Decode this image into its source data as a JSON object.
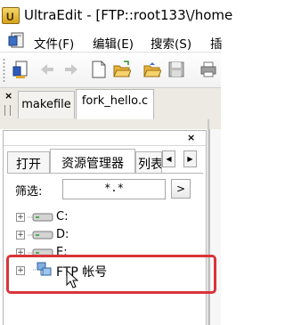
{
  "window": {
    "title": "UltraEdit - [FTP::root133\\/home",
    "app_icon": "ultraedit-app-icon"
  },
  "menubar": {
    "items": [
      "文件(F)",
      "编辑(E)",
      "搜索(S)",
      "插"
    ]
  },
  "toolbar": {
    "buttons": [
      "new-doc-icon",
      "back-arrow-icon",
      "forward-arrow-icon",
      "blank-file-icon",
      "open-folder-icon",
      "open-folder-up-icon",
      "save-icon",
      "print-icon"
    ]
  },
  "file_tabs": {
    "close_glyph": "×",
    "tabs": [
      {
        "label": "makefile",
        "active": false
      },
      {
        "label": "fork_hello.c",
        "active": true
      }
    ]
  },
  "panel": {
    "close_glyph": "×",
    "tabs": [
      {
        "label": "打开",
        "active": false
      },
      {
        "label": "资源管理器",
        "active": true
      },
      {
        "label": "列表",
        "active": false
      }
    ],
    "scroll_left": "◀",
    "scroll_right": "▶",
    "filter": {
      "label": "筛选:",
      "value": "*.*",
      "button": ">"
    },
    "tree": [
      {
        "label": "C:",
        "icon": "drive-icon",
        "expander": "+"
      },
      {
        "label": "D:",
        "icon": "drive-icon",
        "expander": "+"
      },
      {
        "label": "E:",
        "icon": "drive-icon",
        "expander": "+"
      },
      {
        "label": "FTP 帐号",
        "icon": "ftp-accounts-icon",
        "expander": "+"
      }
    ]
  },
  "colors": {
    "highlight": "#d9343a",
    "chrome_bg": "#eceae3"
  }
}
